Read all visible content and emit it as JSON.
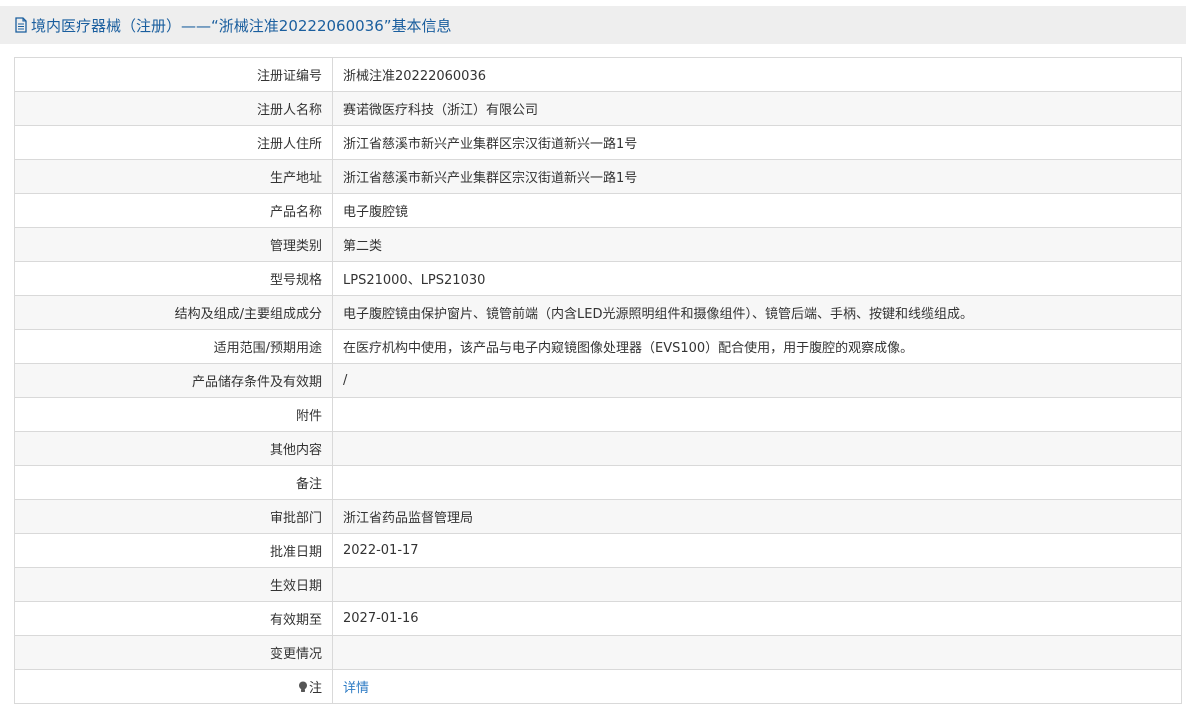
{
  "page": {
    "title": "境内医疗器械（注册）——“浙械注准20222060036”基本信息"
  },
  "icons": {
    "title": "document-icon",
    "note": "lightbulb-icon"
  },
  "colors": {
    "title_text": "#1a5e9e",
    "link": "#2d7bc4",
    "row_alt": "#f7f7f7",
    "border": "#d9d9d9"
  },
  "rows": [
    {
      "label": "注册证编号",
      "value": "浙械注准20222060036"
    },
    {
      "label": "注册人名称",
      "value": "赛诺微医疗科技（浙江）有限公司"
    },
    {
      "label": "注册人住所",
      "value": "浙江省慈溪市新兴产业集群区宗汉街道新兴一路1号"
    },
    {
      "label": "生产地址",
      "value": "浙江省慈溪市新兴产业集群区宗汉街道新兴一路1号"
    },
    {
      "label": "产品名称",
      "value": "电子腹腔镜"
    },
    {
      "label": "管理类别",
      "value": "第二类"
    },
    {
      "label": "型号规格",
      "value": "LPS21000、LPS21030"
    },
    {
      "label": "结构及组成/主要组成成分",
      "value": "电子腹腔镜由保护窗片、镜管前端（内含LED光源照明组件和摄像组件）、镜管后端、手柄、按键和线缆组成。"
    },
    {
      "label": "适用范围/预期用途",
      "value": "在医疗机构中使用，该产品与电子内窥镜图像处理器（EVS100）配合使用，用于腹腔的观察成像。"
    },
    {
      "label": "产品储存条件及有效期",
      "value": "/"
    },
    {
      "label": "附件",
      "value": ""
    },
    {
      "label": "其他内容",
      "value": ""
    },
    {
      "label": "备注",
      "value": ""
    },
    {
      "label": "审批部门",
      "value": "浙江省药品监督管理局"
    },
    {
      "label": "批准日期",
      "value": "2022-01-17"
    },
    {
      "label": "生效日期",
      "value": ""
    },
    {
      "label": "有效期至",
      "value": "2027-01-16"
    },
    {
      "label": "变更情况",
      "value": ""
    }
  ],
  "note_row": {
    "label": "注",
    "link": "详情"
  }
}
